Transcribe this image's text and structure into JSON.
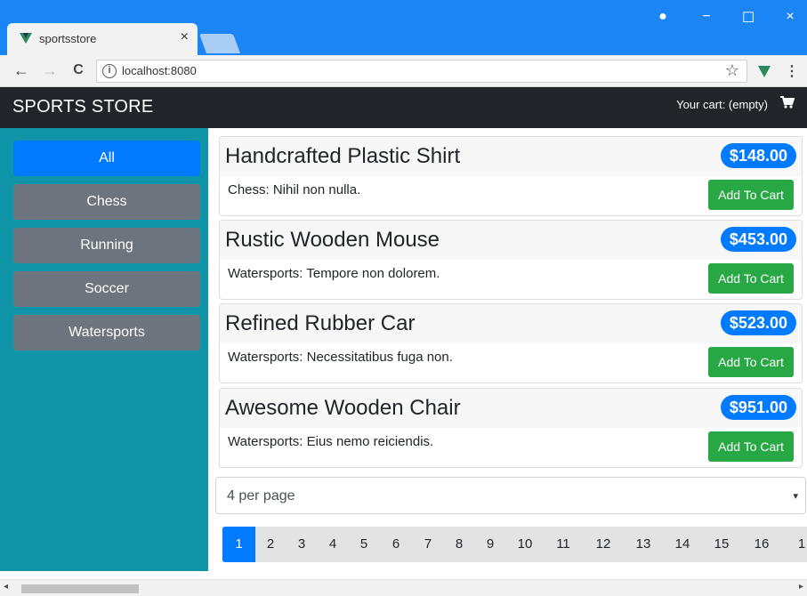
{
  "browser": {
    "tab_title": "sportsstore",
    "tab_close": "×",
    "url": "localhost:8080",
    "info_icon": "i",
    "back": "←",
    "forward": "→",
    "reload": "C",
    "star": "☆",
    "menu": "⋮",
    "window_controls": {
      "account": "●",
      "minimize": "−",
      "maximize": "☐",
      "close": "×"
    }
  },
  "navbar": {
    "brand": "SPORTS STORE",
    "cart_text": "Your cart: (empty)",
    "cart_icon": "shopping-cart-icon"
  },
  "sidebar": {
    "categories": [
      {
        "label": "All",
        "active": true
      },
      {
        "label": "Chess",
        "active": false
      },
      {
        "label": "Running",
        "active": false
      },
      {
        "label": "Soccer",
        "active": false
      },
      {
        "label": "Watersports",
        "active": false
      }
    ]
  },
  "products": [
    {
      "name": "Handcrafted Plastic Shirt",
      "price": "$148.00",
      "description": "Chess: Nihil non nulla.",
      "button": "Add To Cart"
    },
    {
      "name": "Rustic Wooden Mouse",
      "price": "$453.00",
      "description": "Watersports: Tempore non dolorem.",
      "button": "Add To Cart"
    },
    {
      "name": "Refined Rubber Car",
      "price": "$523.00",
      "description": "Watersports: Necessitatibus fuga non.",
      "button": "Add To Cart"
    },
    {
      "name": "Awesome Wooden Chair",
      "price": "$951.00",
      "description": "Watersports: Eius nemo reiciendis.",
      "button": "Add To Cart"
    }
  ],
  "page_size": {
    "selected": "4 per page",
    "caret": "▾"
  },
  "pagination": {
    "pages": [
      "1",
      "2",
      "3",
      "4",
      "5",
      "6",
      "7",
      "8",
      "9",
      "10",
      "11",
      "12",
      "13",
      "14",
      "15",
      "16",
      "1"
    ],
    "active": "1"
  },
  "colors": {
    "titlebar": "#1b85f5",
    "navbar": "#212529",
    "sidebar": "#0f94a8",
    "primary": "#007bff",
    "secondary": "#6c757d",
    "success": "#28a745"
  }
}
